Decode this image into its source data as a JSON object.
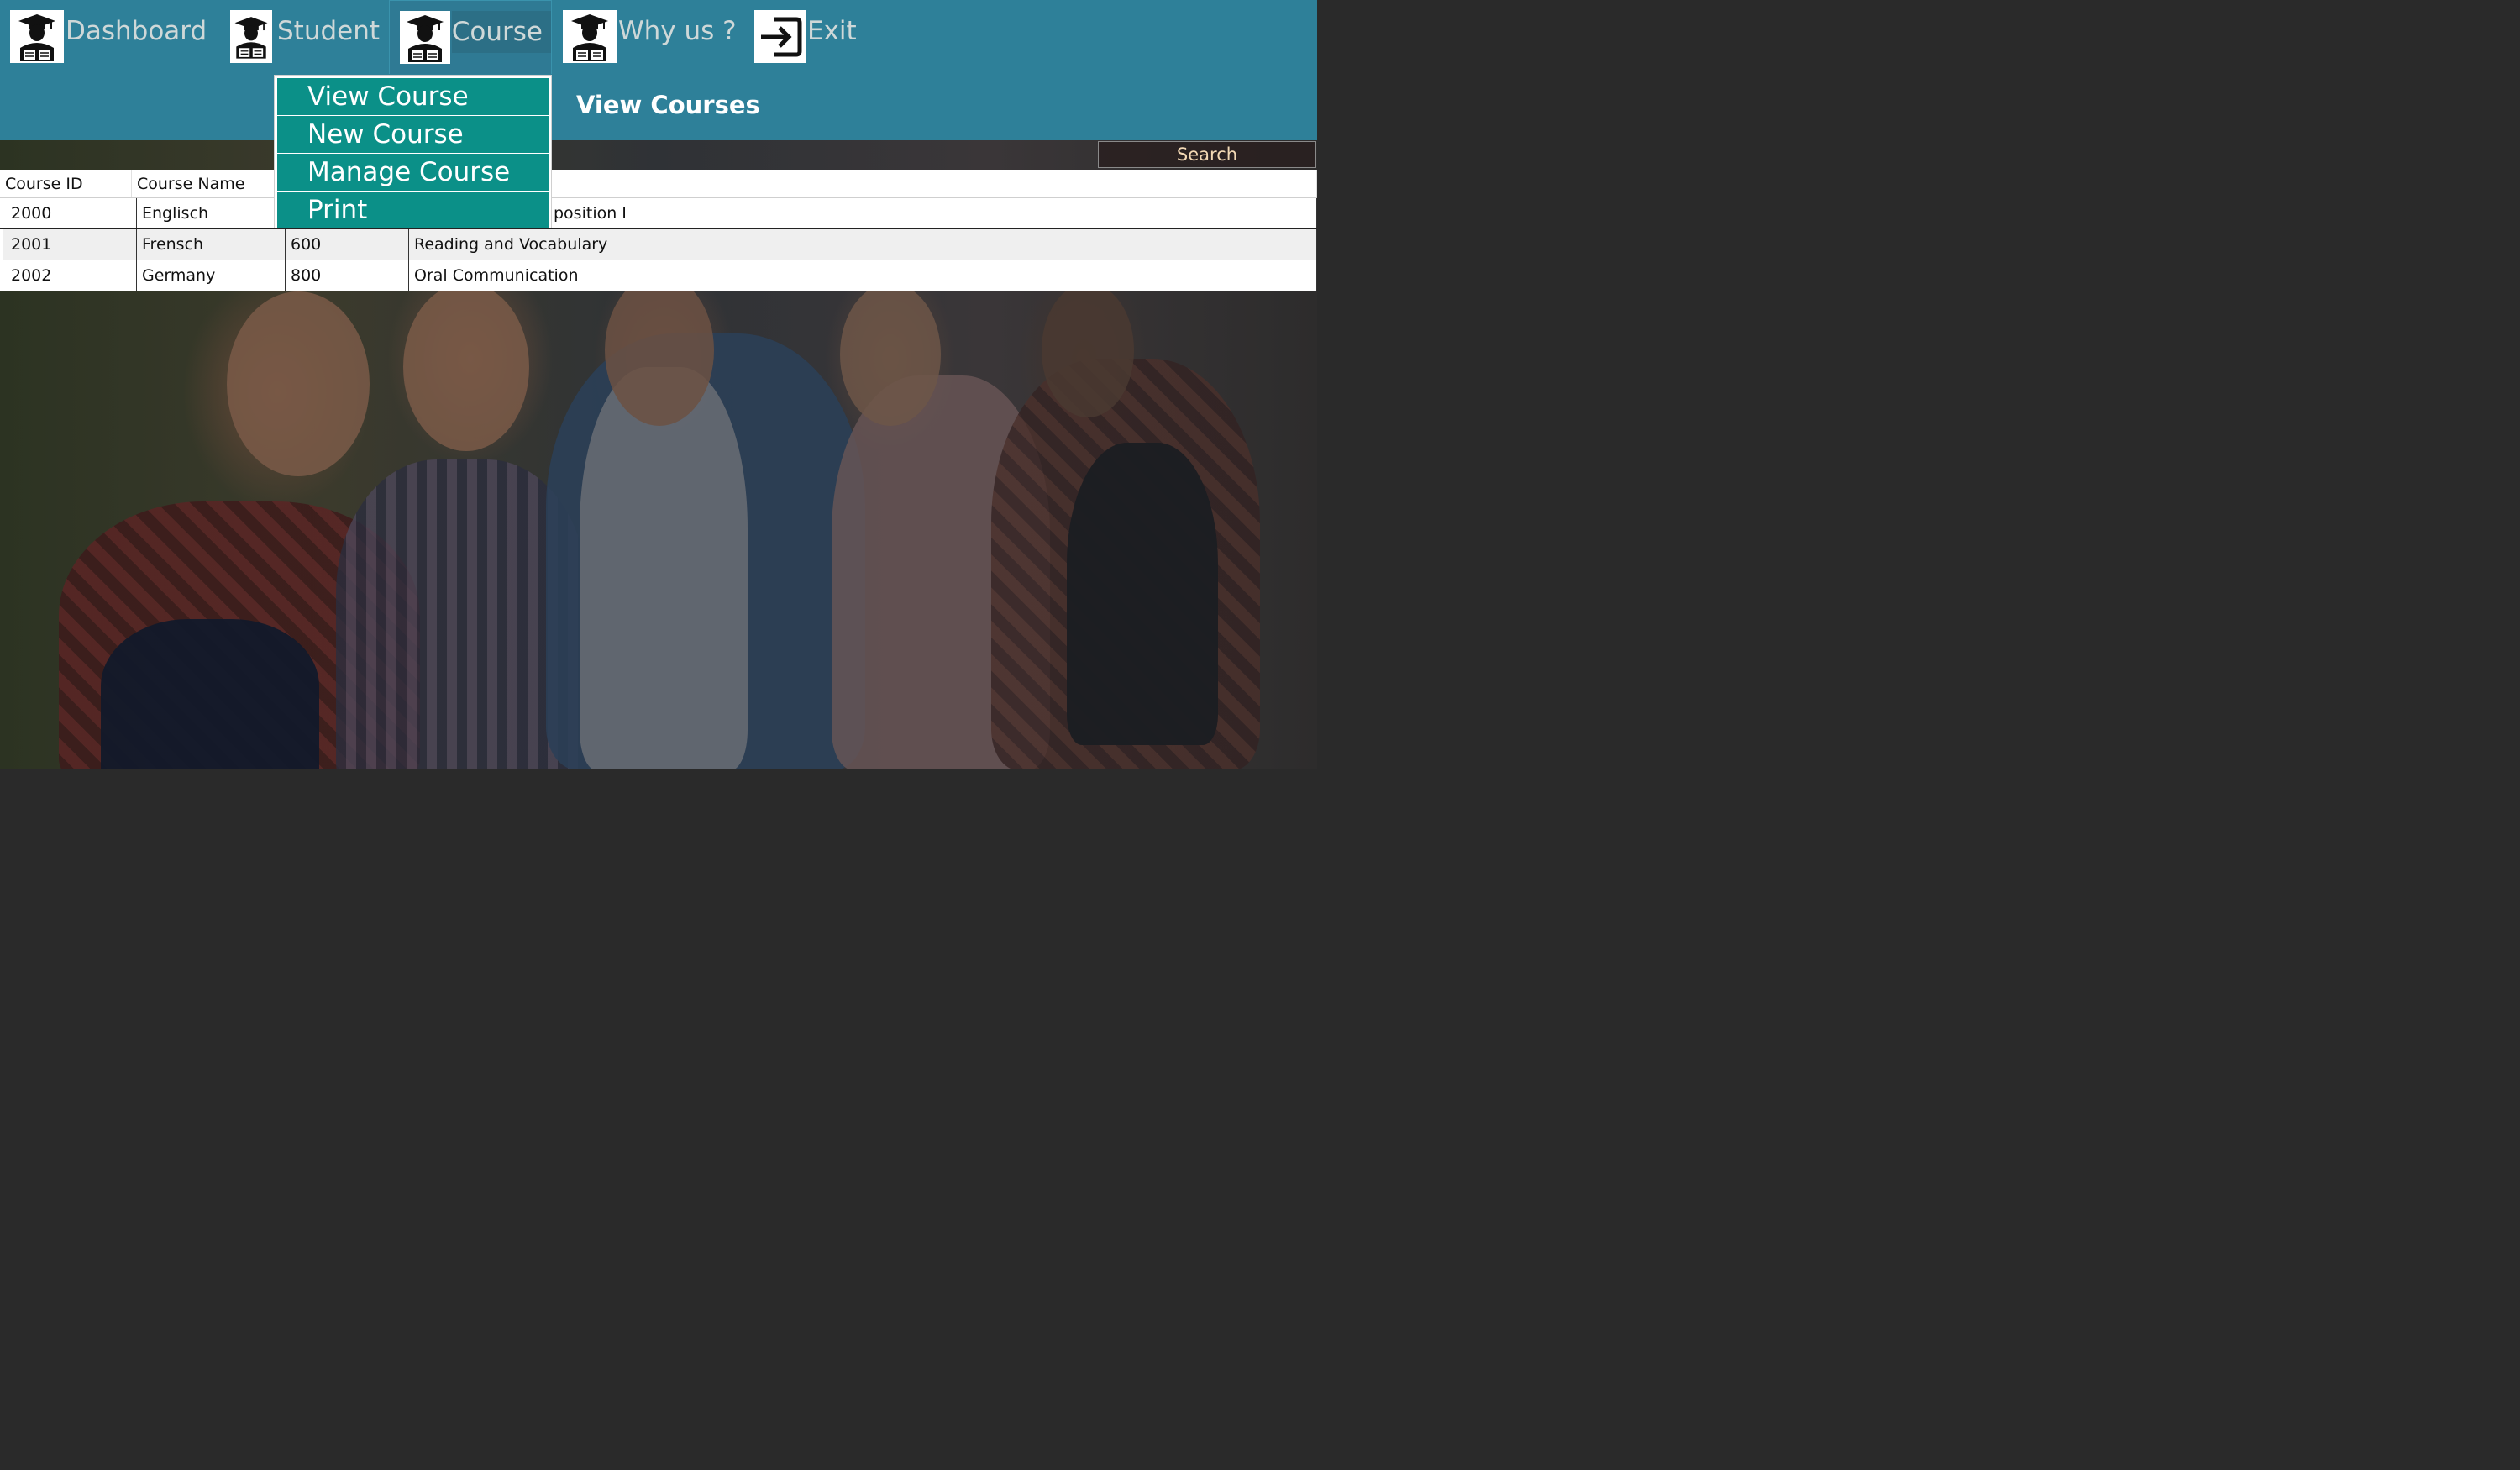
{
  "nav": {
    "items": [
      {
        "label": "Dashboard",
        "icon": "graduate-reading-icon"
      },
      {
        "label": "Student",
        "icon": "graduate-reading-icon"
      },
      {
        "label": "Course",
        "icon": "graduate-reading-icon"
      },
      {
        "label": "Why us ?",
        "icon": "graduate-reading-icon"
      },
      {
        "label": "Exit",
        "icon": "exit-icon"
      }
    ],
    "active": "Course"
  },
  "dropdown": {
    "items": [
      "View Course",
      "New Course",
      "Manage Course",
      "Print"
    ]
  },
  "page": {
    "heading": "View Courses"
  },
  "search": {
    "label": "Search"
  },
  "table": {
    "headers": [
      "Course ID",
      "Course Name",
      "",
      ""
    ],
    "rows": [
      [
        "2000",
        "Englisch",
        "",
        "position I"
      ],
      [
        "2001",
        "Frensch",
        "600",
        "Reading and Vocabulary"
      ],
      [
        "2002",
        "Germany",
        "800",
        "Oral Communication"
      ]
    ]
  },
  "colors": {
    "header_bar": "#2e8099",
    "menu_item": "#0b9088"
  }
}
